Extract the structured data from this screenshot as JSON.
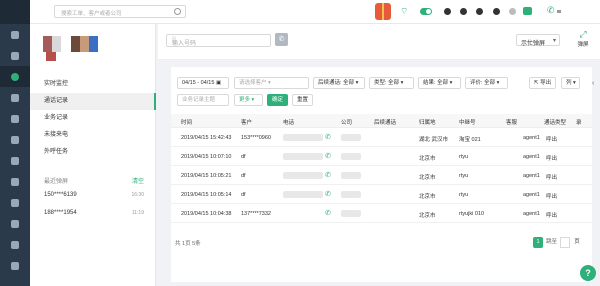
{
  "topbar": {
    "search_placeholder": "搜索工单、客户或者公司"
  },
  "rail": {
    "items": [
      "logo",
      "home-icon",
      "menu-icon",
      "phone-icon",
      "chat-icon",
      "report-icon",
      "analytics-icon",
      "clock-icon",
      "send-icon",
      "settings-icon",
      "grid-icon",
      "help-icon"
    ]
  },
  "dialer": {
    "number_placeholder": "输入号码",
    "busy_select": "示忙弹屏",
    "hangup_label": "弹屏"
  },
  "sidebar": {
    "items": [
      {
        "label": "实时监控"
      },
      {
        "label": "通话记录"
      },
      {
        "label": "业务记录"
      },
      {
        "label": "未接来电"
      },
      {
        "label": "外呼任务"
      }
    ],
    "recent_title": "最近弹屏",
    "clear_label": "清空",
    "recent": [
      {
        "phone": "150****6139",
        "time": "16:30"
      },
      {
        "phone": "188****1954",
        "time": "11:19"
      }
    ]
  },
  "filters": {
    "date_range": "04/15 - 04/15",
    "customer_placeholder": "请选择客户",
    "result_filter": "后续通话: 全部",
    "type_filter": "类型: 全部",
    "outcome_filter": "结果: 全部",
    "rating_filter": "评价: 全部",
    "export_label": "导出",
    "col_label": "列",
    "theme_placeholder": "业务记录主题",
    "more_label": "更多",
    "confirm_label": "确定",
    "reset_label": "重置"
  },
  "table": {
    "headers": [
      "时间",
      "客户",
      "电话",
      "公司",
      "后续通话",
      "归属地",
      "中继号",
      "客服",
      "通话类型",
      "录"
    ],
    "rows": [
      {
        "time": "2019/04/15 15:42:43",
        "customer": "153****0960",
        "location": "湖北 武汉市",
        "trunk": "淘宝 021",
        "agent": "agent1",
        "type": "呼出"
      },
      {
        "time": "2019/04/15 10:07:10",
        "customer": "df",
        "location": "北京市",
        "trunk": "rtyu",
        "agent": "agent1",
        "type": "呼出"
      },
      {
        "time": "2019/04/15 10:05:21",
        "customer": "df",
        "location": "北京市",
        "trunk": "rtyu",
        "agent": "agent1",
        "type": "呼出"
      },
      {
        "time": "2019/04/15 10:05:14",
        "customer": "df",
        "location": "北京市",
        "trunk": "rtyu",
        "agent": "agent1",
        "type": "呼出"
      },
      {
        "time": "2019/04/15 10:04:38",
        "customer": "137****7332",
        "location": "北京市",
        "trunk": "rtyujki 010",
        "agent": "agent1",
        "type": "呼出"
      }
    ]
  },
  "pagination": {
    "summary": "共 1页 5条",
    "current_page": "1",
    "goto_label": "跳至",
    "page_suffix": "页"
  },
  "help_label": "?"
}
